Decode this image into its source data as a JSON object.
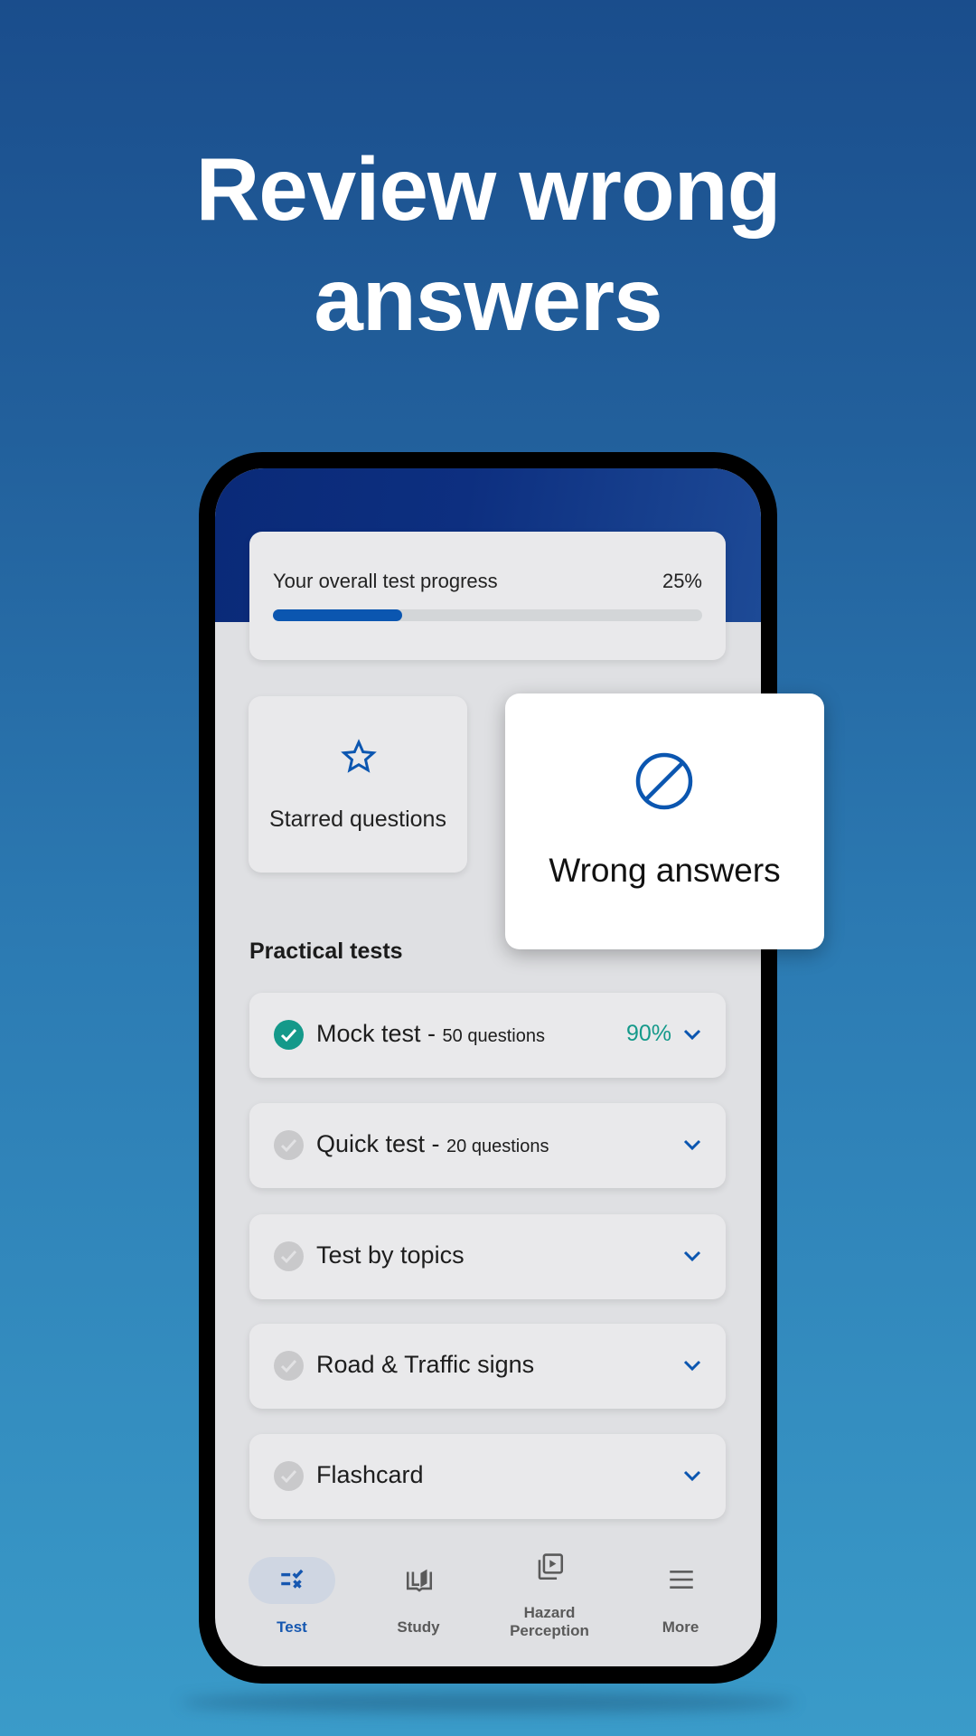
{
  "headline": {
    "line1": "Review wrong",
    "line2": "answers"
  },
  "colors": {
    "accent": "#0b56b0",
    "success": "#14998a",
    "inactive_check": "#c9c9cb"
  },
  "progress": {
    "label": "Your overall test progress",
    "value_text": "25%",
    "fraction": 0.3
  },
  "quick_cards": {
    "starred": {
      "label": "Starred questions",
      "icon": "star-outline-icon"
    },
    "wrong": {
      "label": "Wrong answers",
      "icon": "block-icon"
    }
  },
  "practical": {
    "title": "Practical tests",
    "items": [
      {
        "title": "Mock test - ",
        "sub": "50 questions",
        "score": "90%",
        "done": true
      },
      {
        "title": "Quick test - ",
        "sub": " 20 questions",
        "score": "",
        "done": false
      },
      {
        "title": "Test by topics",
        "sub": "",
        "score": "",
        "done": false
      },
      {
        "title": "Road & Traffic signs",
        "sub": "",
        "score": "",
        "done": false
      },
      {
        "title": "Flashcard",
        "sub": "",
        "score": "",
        "done": false
      }
    ]
  },
  "nav": [
    {
      "label": "Test",
      "icon": "test-checklist-icon",
      "active": true
    },
    {
      "label": "Study",
      "icon": "book-icon",
      "active": false
    },
    {
      "label": "Hazard\nPerception",
      "icon": "video-library-icon",
      "active": false
    },
    {
      "label": "More",
      "icon": "menu-icon",
      "active": false
    }
  ]
}
